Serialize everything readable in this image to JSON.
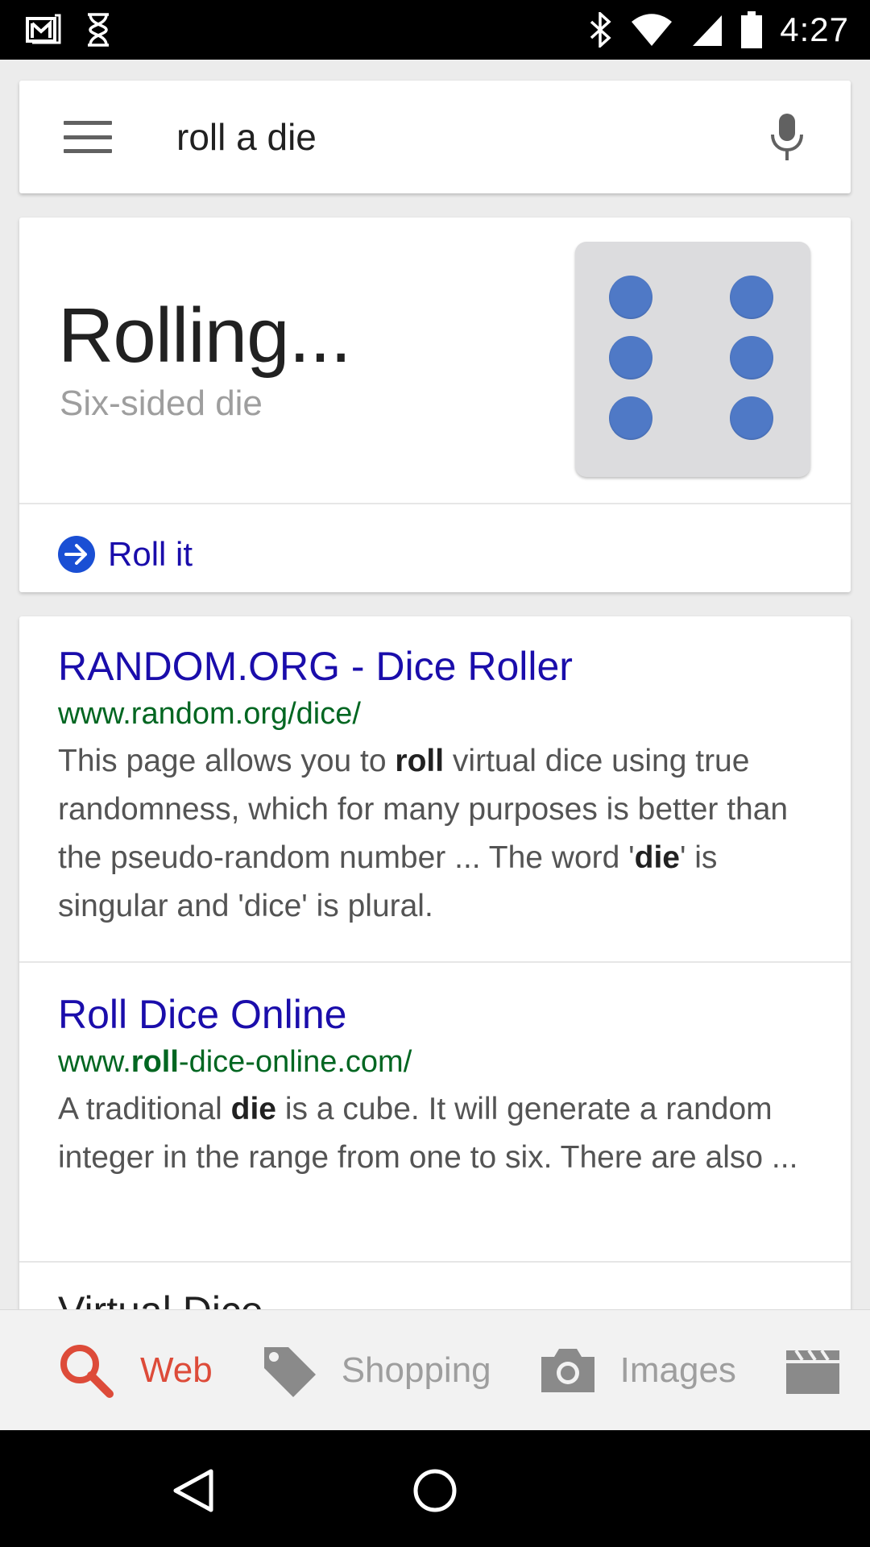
{
  "status_bar": {
    "time": "4:27",
    "left_icons": [
      "gmail-icon",
      "hourglass-icon"
    ],
    "right_icons": [
      "bluetooth-icon",
      "wifi-icon",
      "cell-signal-icon",
      "battery-icon"
    ]
  },
  "search": {
    "query": "roll a die",
    "menu_icon": "menu-icon",
    "mic_icon": "microphone-icon"
  },
  "dice": {
    "title": "Rolling...",
    "subtitle": "Six-sided die",
    "face_value": 6,
    "pip_color": "#4f79c6",
    "roll_button_label": "Roll it",
    "roll_icon": "arrow-right-circle-icon"
  },
  "results": [
    {
      "title": "RANDOM.ORG - Dice Roller",
      "url": "www.random.org/dice/",
      "snippet_parts": [
        {
          "text": "This page allows you to ",
          "bold": false
        },
        {
          "text": "roll",
          "bold": true
        },
        {
          "text": " virtual dice using true randomness, which for many purposes is better than the pseudo-random number ... The word '",
          "bold": false
        },
        {
          "text": "die",
          "bold": true
        },
        {
          "text": "' is singular and 'dice' is plural.",
          "bold": false
        }
      ]
    },
    {
      "title": "Roll Dice Online",
      "url_parts": [
        {
          "text": "www.",
          "bold": false
        },
        {
          "text": "roll",
          "bold": true
        },
        {
          "text": "-dice-online.com/",
          "bold": false
        }
      ],
      "snippet_parts": [
        {
          "text": "A traditional ",
          "bold": false
        },
        {
          "text": "die",
          "bold": true
        },
        {
          "text": " is a cube. It will generate a random integer in the range from one to six. There are also ...",
          "bold": false
        }
      ]
    },
    {
      "title": "Virtual Dice"
    }
  ],
  "tabs": [
    {
      "label": "Web",
      "icon": "search-icon",
      "active": true
    },
    {
      "label": "Shopping",
      "icon": "tag-icon",
      "active": false
    },
    {
      "label": "Images",
      "icon": "camera-icon",
      "active": false
    },
    {
      "label": "",
      "icon": "video-clapper-icon",
      "active": false
    }
  ],
  "nav": {
    "back_icon": "back-triangle-icon",
    "home_icon": "home-circle-icon"
  },
  "colors": {
    "link": "#1a0dab",
    "url": "#006621",
    "active_tab": "#dd4b39",
    "roll_icon_bg": "#1a4fd4"
  }
}
